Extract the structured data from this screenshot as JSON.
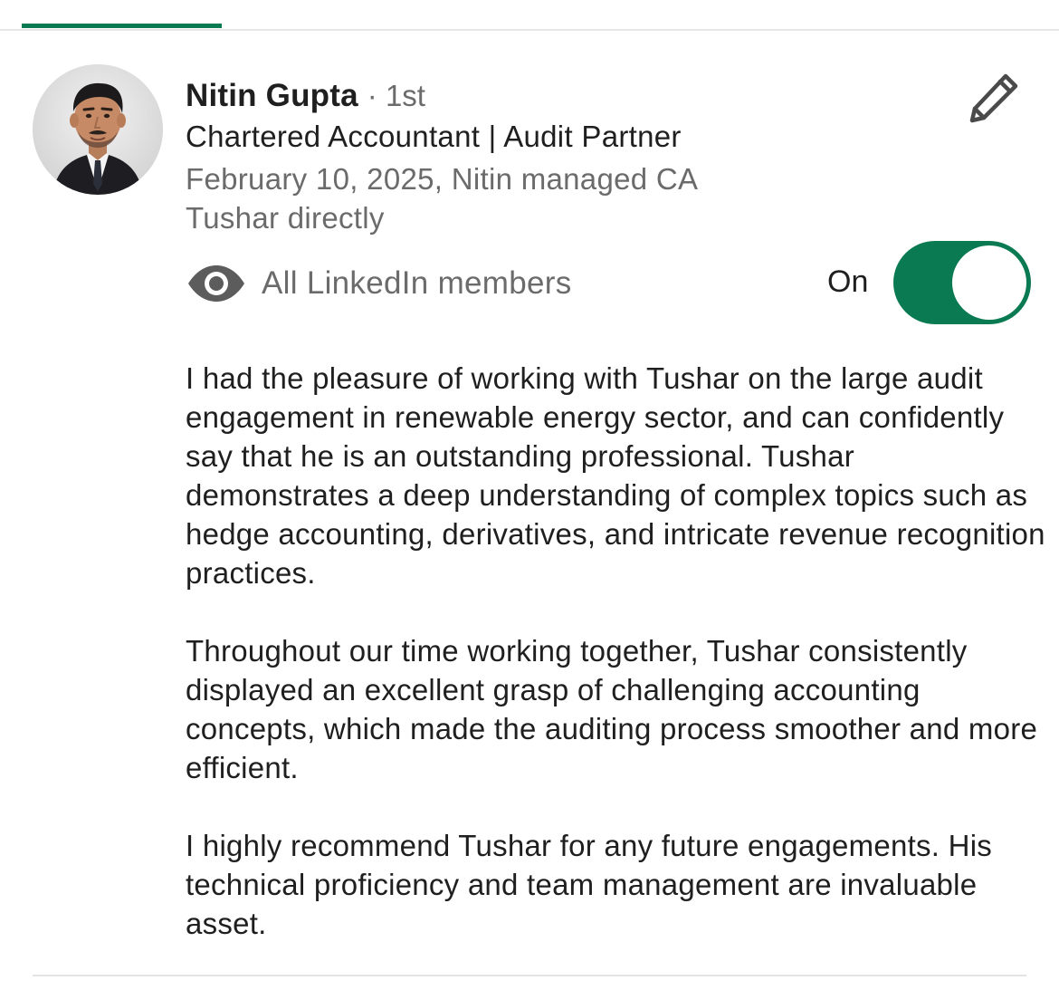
{
  "tabs": {
    "active_indicator_color": "#0a7a52"
  },
  "recommendation": {
    "author": {
      "name": "Nitin Gupta",
      "degree": "· 1st",
      "headline": "Chartered Accountant | Audit Partner",
      "relation": "February 10, 2025, Nitin managed CA Tushar directly",
      "avatar_icon": "profile-photo"
    },
    "edit_icon": "pencil-icon",
    "visibility": {
      "icon": "eye-icon",
      "label": "All LinkedIn members",
      "toggle_label": "On",
      "toggle_on": true,
      "toggle_color": "#0a7a52"
    },
    "paragraphs": [
      "I had the pleasure of working with Tushar on the large audit engagement in renewable energy sector, and can confidently say that he is an outstanding professional. Tushar demonstrates a deep understanding of complex topics such as hedge accounting, derivatives, and intricate revenue recognition practices.",
      "Throughout our time working together, Tushar consistently displayed an excellent grasp of challenging accounting concepts, which made the auditing process smoother and more efficient.",
      "I highly recommend Tushar for any future engagements. His technical proficiency and team management are invaluable asset."
    ]
  }
}
